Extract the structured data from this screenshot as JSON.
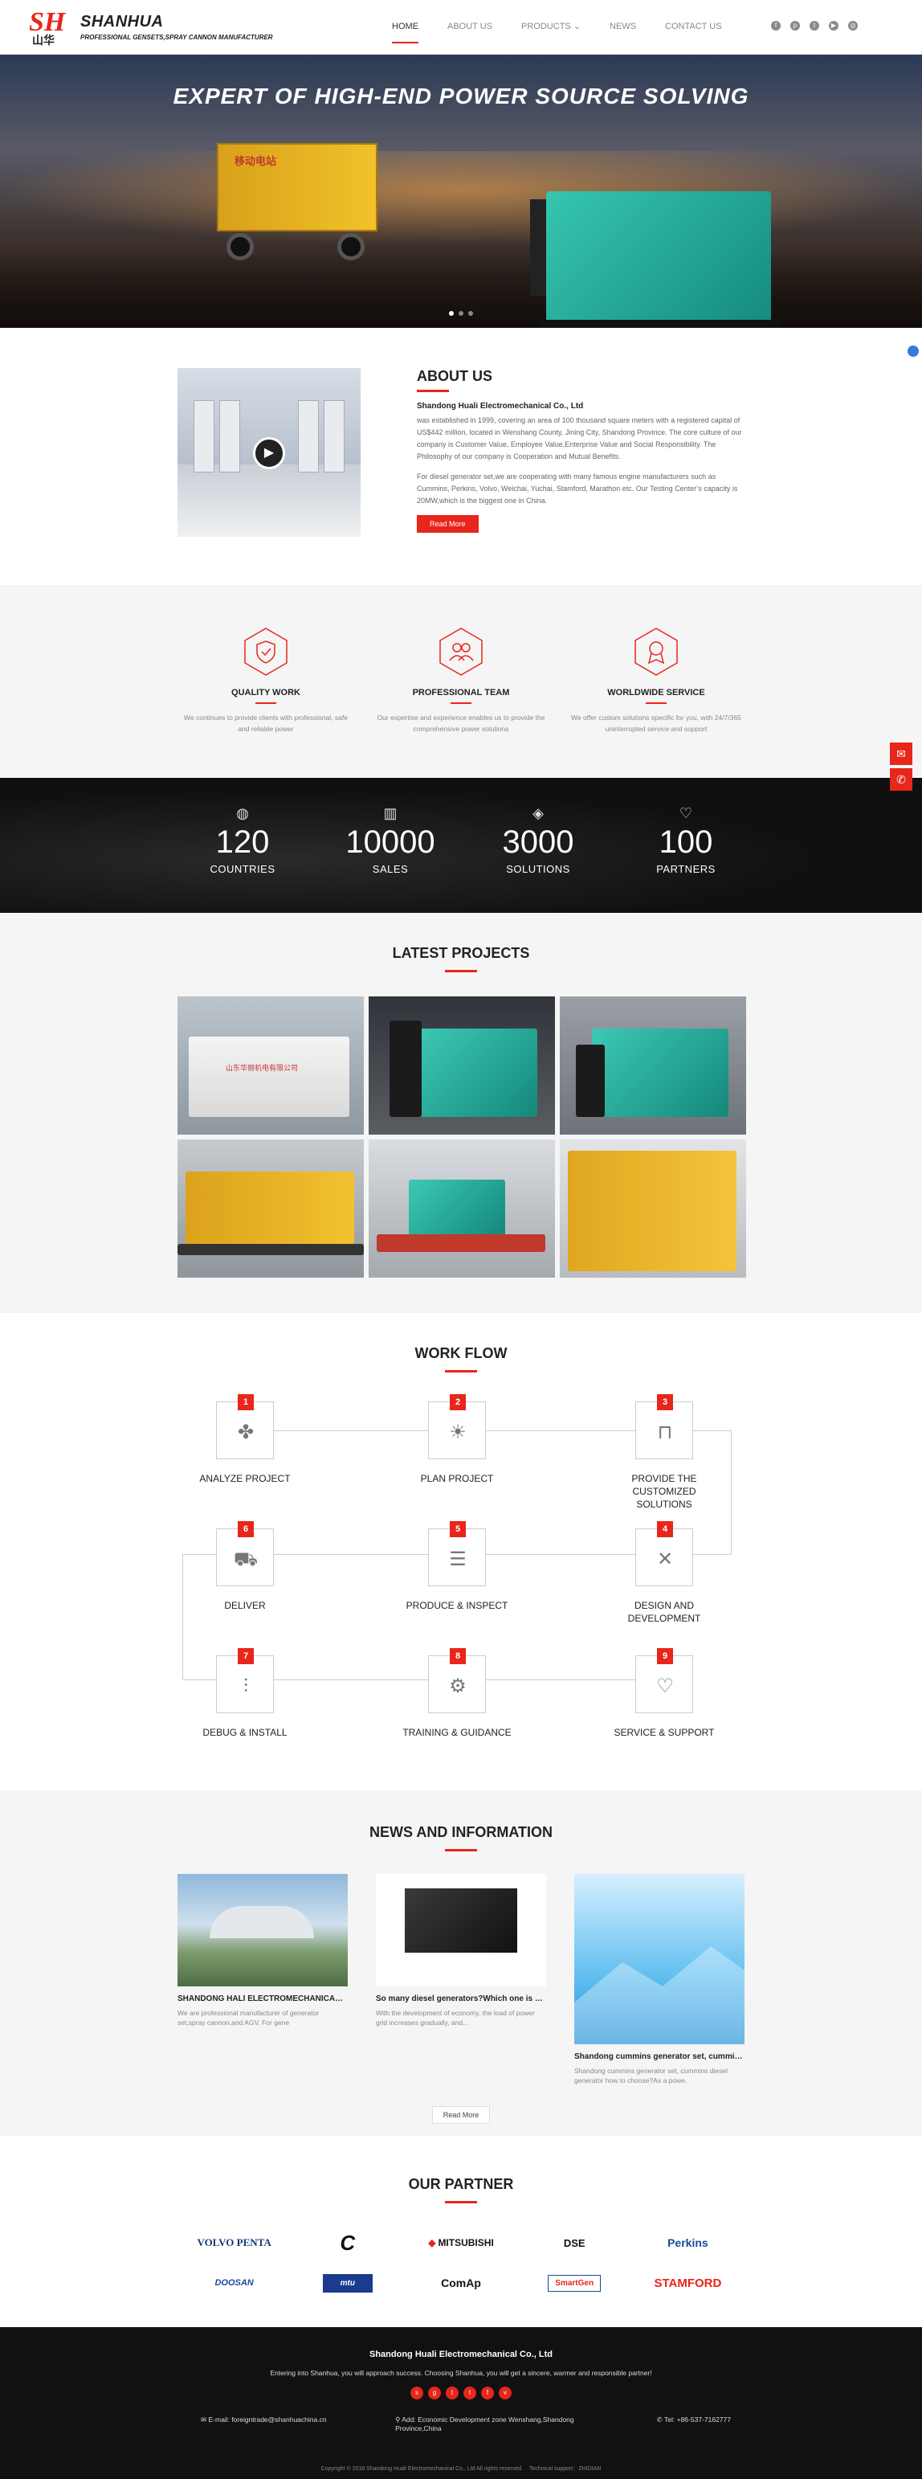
{
  "header": {
    "brand_name": "SHANHUA",
    "brand_sub": "PROFESSIONAL GENSETS,SPRAY CANNON MANUFACTURER",
    "nav": [
      "HOME",
      "ABOUT US",
      "PRODUCTS",
      "NEWS",
      "CONTACT US"
    ],
    "social_icons": [
      "facebook-icon",
      "pinterest-icon",
      "twitter-icon",
      "youtube-icon",
      "instagram-icon"
    ]
  },
  "hero": {
    "title": "EXPERT OF HIGH-END POWER SOURCE SOLVING",
    "trailer_text": "移动电站"
  },
  "about": {
    "title": "ABOUT US",
    "company": "Shandong Huali Electromechanical Co., Ltd",
    "p1": "was established in 1999, covering an area of 100 thousand square meters with a registered capital of US$442 million, located in Wenshang County, Jining City, Shandong Province. The core culture of our company is Customer Value, Employee Value,Enterprise Value and Social Responsibility. The Philosophy of our company is Cooperation and Mutual Benefits.",
    "p2": "For diesel generator set,we are cooperating with many famous engine manufacturers such as Cummins, Perkins, Volvo, Weichai, Yuchai, Stamford, Marathon etc. Our Testing Center’s capacity is 20MW,which is the biggest one in China.",
    "button": "Read More"
  },
  "features": [
    {
      "title": "QUALITY WORK",
      "text": "We continues to provide clients with professional, safe and reliable power"
    },
    {
      "title": "PROFESSIONAL TEAM",
      "text": "Our expertise and experience enables us to provide the comprehensive power solutions"
    },
    {
      "title": "WORLDWIDE SERVICE",
      "text": "We offer custom solutions specific for you, with 24/7/365 uninterrupted service and support"
    }
  ],
  "stats": [
    {
      "num": "120",
      "label": "COUNTRIES"
    },
    {
      "num": "10000",
      "label": "SALES"
    },
    {
      "num": "3000",
      "label": "SOLUTIONS"
    },
    {
      "num": "100",
      "label": "PARTNERS"
    }
  ],
  "projects": {
    "title": "LATEST PROJECTS",
    "watermark": "山东华丽机电有限公司"
  },
  "workflow": {
    "title": "WORK FLOW",
    "steps": [
      {
        "n": "1",
        "label": "ANALYZE PROJECT"
      },
      {
        "n": "2",
        "label": "PLAN PROJECT"
      },
      {
        "n": "3",
        "label": "PROVIDE THE CUSTOMIZED SOLUTIONS"
      },
      {
        "n": "4",
        "label": "DESIGN AND DEVELOPMENT"
      },
      {
        "n": "5",
        "label": "PRODUCE & INSPECT"
      },
      {
        "n": "6",
        "label": "DELIVER"
      },
      {
        "n": "7",
        "label": "DEBUG & INSTALL"
      },
      {
        "n": "8",
        "label": "TRAINING & GUIDANCE"
      },
      {
        "n": "9",
        "label": "SERVICE & SUPPORT"
      }
    ]
  },
  "news": {
    "title": "NEWS AND INFORMATION",
    "items": [
      {
        "title": "SHANDONG HALI ELECTROMECHANICAL ...",
        "text": "We are professional manufacturer of generator set,spray cannon,and AGV. For gene"
      },
      {
        "title": "So many diesel generators?Which one is m...",
        "text": "With the development of economy, the load of power grid increases gradually, and..."
      },
      {
        "title": "Shandong cummins generator set, cummins...",
        "text": "Shandong cummins generator set, cummins diesel generator how to choose?As a powe."
      }
    ],
    "button": "Read More"
  },
  "partners": {
    "title": "OUR PARTNER",
    "logos": [
      "VOLVO PENTA",
      "Cummins",
      "MITSUBISHI",
      "DSE",
      "Perkins",
      "DOOSAN",
      "mtu",
      "ComAp",
      "SmartGen",
      "STAMFORD"
    ]
  },
  "footer": {
    "company": "Shandong Huali Electromechanical Co., Ltd",
    "tagline": "Entering into Shanhua, you will approach success. Choosing Shanhua, you will get a sincere, warmer and responsible partner!",
    "email": "E-mail: foreigntrade@shanhuachina.cn",
    "address": "Add: Economic Development zone Wenshang,Shandong Province,China",
    "tel": "Tel: +86-537-7162777",
    "copyright": "Copyright © 2018 Shandong Huali Electromechanical Co., Ltd All rights reserved.",
    "support": "Technical support：ZHIDIAN"
  },
  "colors": {
    "accent": "#e8261b",
    "dark": "#111111"
  }
}
